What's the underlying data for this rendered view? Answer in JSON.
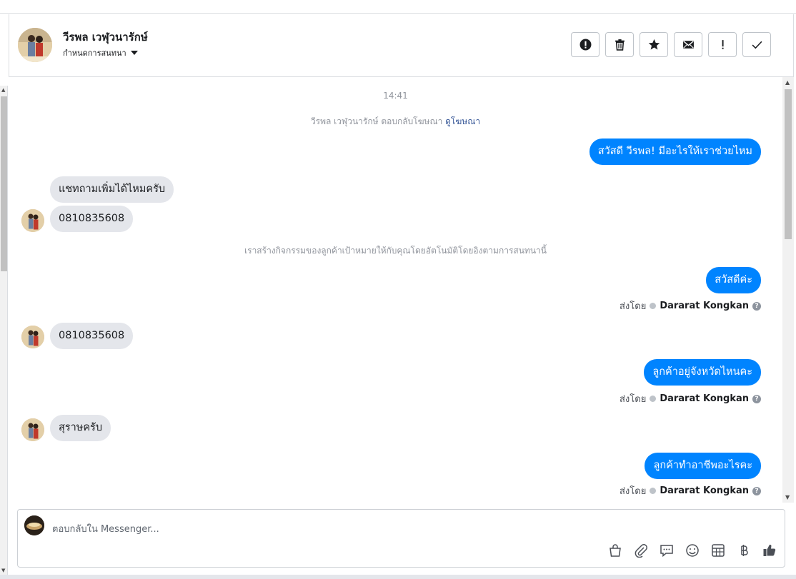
{
  "header": {
    "contact_name": "วีรพล เวฬุวนารักษ์",
    "conversation_menu": "กำหนดการสนทนา",
    "actions": [
      {
        "icon": "alert-circle-icon",
        "name": "spam-button"
      },
      {
        "icon": "trash-icon",
        "name": "delete-button"
      },
      {
        "icon": "star-icon",
        "name": "star-button"
      },
      {
        "icon": "envelope-icon",
        "name": "mark-unread-button"
      },
      {
        "icon": "exclamation-icon",
        "name": "follow-up-button"
      },
      {
        "icon": "check-icon",
        "name": "done-button"
      }
    ]
  },
  "chat": {
    "timestamp": "14:41",
    "ad_reply": {
      "text": "วีรพล เวฬุวนารักษ์ ตอบกลับโฆษณา",
      "link": "ดูโฆษณา"
    },
    "auto_activity": "เราสร้างกิจกรรมของลูกค้าเป้าหมายให้กับคุณโดยอัตโนมัติโดยอิงตามการสนทนานี้",
    "sent_by_label": "ส่งโดย",
    "sender_name": "Dararat Kongkan",
    "messages": [
      {
        "dir": "out",
        "text": "สวัสดี วีรพล! มีอะไรให้เราช่วยไหม"
      },
      {
        "dir": "in",
        "text": "แชทถามเพิ่มได้ไหมครับ"
      },
      {
        "dir": "in",
        "text": "0810835608"
      },
      {
        "dir": "out",
        "text": "สวัสดีค่ะ"
      },
      {
        "dir": "in",
        "text": "0810835608"
      },
      {
        "dir": "out",
        "text": "ลูกค้าอยู่จังหวัดไหนคะ"
      },
      {
        "dir": "in",
        "text": "สุราษครับ"
      },
      {
        "dir": "out",
        "text": "ลูกค้าทำอาชีพอะไรคะ"
      }
    ]
  },
  "composer": {
    "placeholder": "ตอบกลับใน Messenger...",
    "tools": [
      "shopping-bag-icon",
      "paperclip-icon",
      "saved-reply-icon",
      "emoji-icon",
      "appointment-table-icon",
      "baht-icon",
      "like-icon"
    ]
  },
  "colors": {
    "outgoing_bubble": "#0084ff",
    "incoming_bubble": "#e4e6eb",
    "link": "#385898"
  }
}
